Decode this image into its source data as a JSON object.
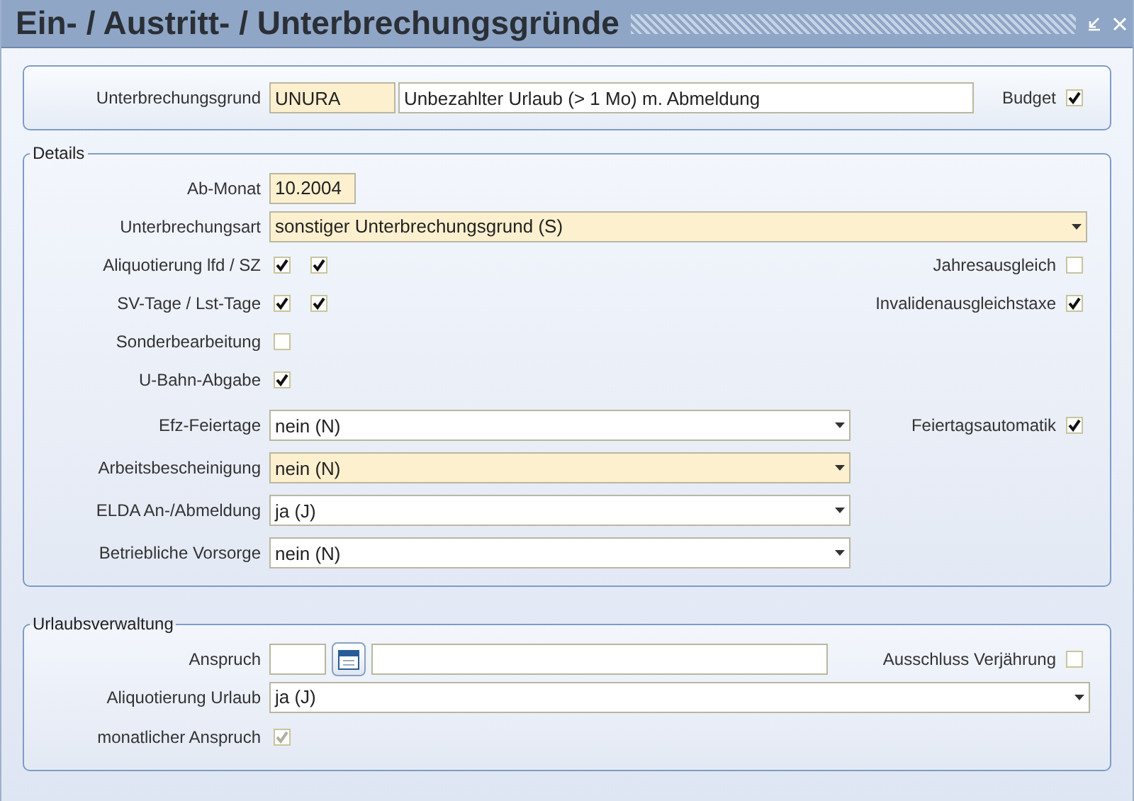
{
  "window": {
    "title": "Ein- / Austritt- / Unterbrechungsgründe"
  },
  "header": {
    "label": "Unterbrechungsgrund",
    "code": {
      "value": "UNURA",
      "required": true
    },
    "description": {
      "value": "Unbezahlter Urlaub (> 1 Mo) m. Abmeldung",
      "required": false
    },
    "budget": {
      "label": "Budget",
      "checked": true
    }
  },
  "details": {
    "legend": "Details",
    "upper": [
      {
        "kind": "text",
        "label": "Ab-Monat",
        "value": "10.2004",
        "required": true
      },
      {
        "kind": "select",
        "label": "Unterbrechungsart",
        "value": "sonstiger Unterbrechungsgrund (S)",
        "required": true
      },
      {
        "kind": "checks",
        "label": "Aliquotierung lfd / SZ",
        "checks": [
          {
            "checked": true
          },
          {
            "checked": true
          }
        ],
        "side": {
          "label": "Jahresausgleich",
          "checked": false
        }
      },
      {
        "kind": "checks",
        "label": "SV-Tage / Lst-Tage",
        "checks": [
          {
            "checked": true
          },
          {
            "checked": true
          }
        ],
        "side": {
          "label": "Invalidenausgleichstaxe",
          "checked": true
        }
      },
      {
        "kind": "checks",
        "label": "Sonderbearbeitung",
        "checks": [
          {
            "checked": false
          }
        ]
      },
      {
        "kind": "checks",
        "label": "U-Bahn-Abgabe",
        "checks": [
          {
            "checked": true
          }
        ]
      }
    ],
    "lower": [
      {
        "kind": "select",
        "label": "Efz-Feiertage",
        "value": "nein (N)",
        "required": false,
        "side": {
          "label": "Feiertagsautomatik",
          "checked": true
        }
      },
      {
        "kind": "select",
        "label": "Arbeitsbescheinigung",
        "value": "nein (N)",
        "required": true
      },
      {
        "kind": "select",
        "label": "ELDA An-/Abmeldung",
        "value": "ja (J)",
        "required": false
      },
      {
        "kind": "select",
        "label": "Betriebliche Vorsorge",
        "value": "nein (N)",
        "required": false
      }
    ]
  },
  "vacation": {
    "legend": "Urlaubsverwaltung",
    "claim": {
      "label": "Anspruch",
      "value_required": false,
      "side": {
        "label": "Ausschluss Verjährung",
        "checked": false
      }
    },
    "rows": [
      {
        "kind": "select",
        "label": "Aliquotierung Urlaub",
        "value": "ja (J)",
        "required": false
      },
      {
        "kind": "checks",
        "label": "monatlicher Anspruch",
        "checks": [
          {
            "checked": true,
            "disabled": true
          }
        ]
      }
    ]
  }
}
